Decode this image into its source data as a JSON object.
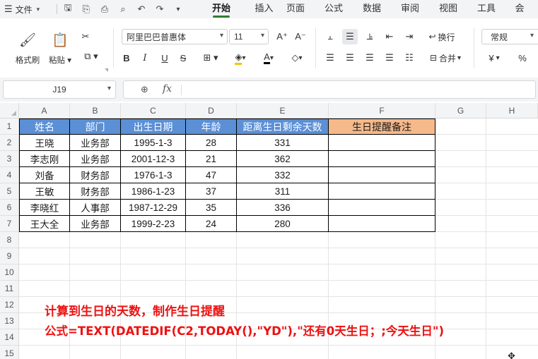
{
  "menubar": {
    "file_label": "文件",
    "menu_icon": "hamburger-icon",
    "quick_icons": [
      "save-icon",
      "share-icon",
      "print-icon",
      "print-preview-icon",
      "undo-icon",
      "redo-icon",
      "more-chevron-icon"
    ],
    "tabs": [
      "开始",
      "插入",
      "页面",
      "公式",
      "数据",
      "审阅",
      "视图",
      "工具",
      "会"
    ],
    "active_tab": "开始",
    "accent_color": "#2e7d32"
  },
  "ribbon": {
    "format_painter": "格式刷",
    "paste": "粘贴",
    "font_name": "阿里巴巴普惠体",
    "font_size": "11",
    "wrap": "换行",
    "merge": "合并",
    "number_format": "常规",
    "currency_symbol": "¥",
    "percent_symbol": "%"
  },
  "formula_bar": {
    "cell_ref": "J19",
    "fx": "fx",
    "formula": ""
  },
  "grid": {
    "columns": [
      "A",
      "B",
      "C",
      "D",
      "E",
      "F",
      "G",
      "H"
    ],
    "rows": [
      "1",
      "2",
      "3",
      "4",
      "5",
      "6",
      "7",
      "8",
      "9",
      "10",
      "11",
      "12",
      "13",
      "14",
      "15"
    ],
    "header_color": "#5b8fd6",
    "accent_header_color": "#f5b98a"
  },
  "table": {
    "headers": [
      "姓名",
      "部门",
      "出生日期",
      "年龄",
      "距离生日剩余天数",
      "生日提醒备注"
    ],
    "rows": [
      [
        "王晓",
        "业务部",
        "1995-1-3",
        "28",
        "331",
        ""
      ],
      [
        "李志刚",
        "业务部",
        "2001-12-3",
        "21",
        "362",
        ""
      ],
      [
        "刘备",
        "财务部",
        "1976-1-3",
        "47",
        "332",
        ""
      ],
      [
        "王敏",
        "财务部",
        "1986-1-23",
        "37",
        "311",
        ""
      ],
      [
        "李晓红",
        "人事部",
        "1987-12-29",
        "35",
        "336",
        ""
      ],
      [
        "王大全",
        "业务部",
        "1999-2-23",
        "24",
        "280",
        ""
      ]
    ]
  },
  "annotation": {
    "line1": "计算到生日的天数，制作生日提醒",
    "line2": "公式=TEXT(DATEDIF(C2,TODAY(),\"YD\"),\"还有0天生日；;今天生日\")",
    "color": "#ee1111"
  }
}
